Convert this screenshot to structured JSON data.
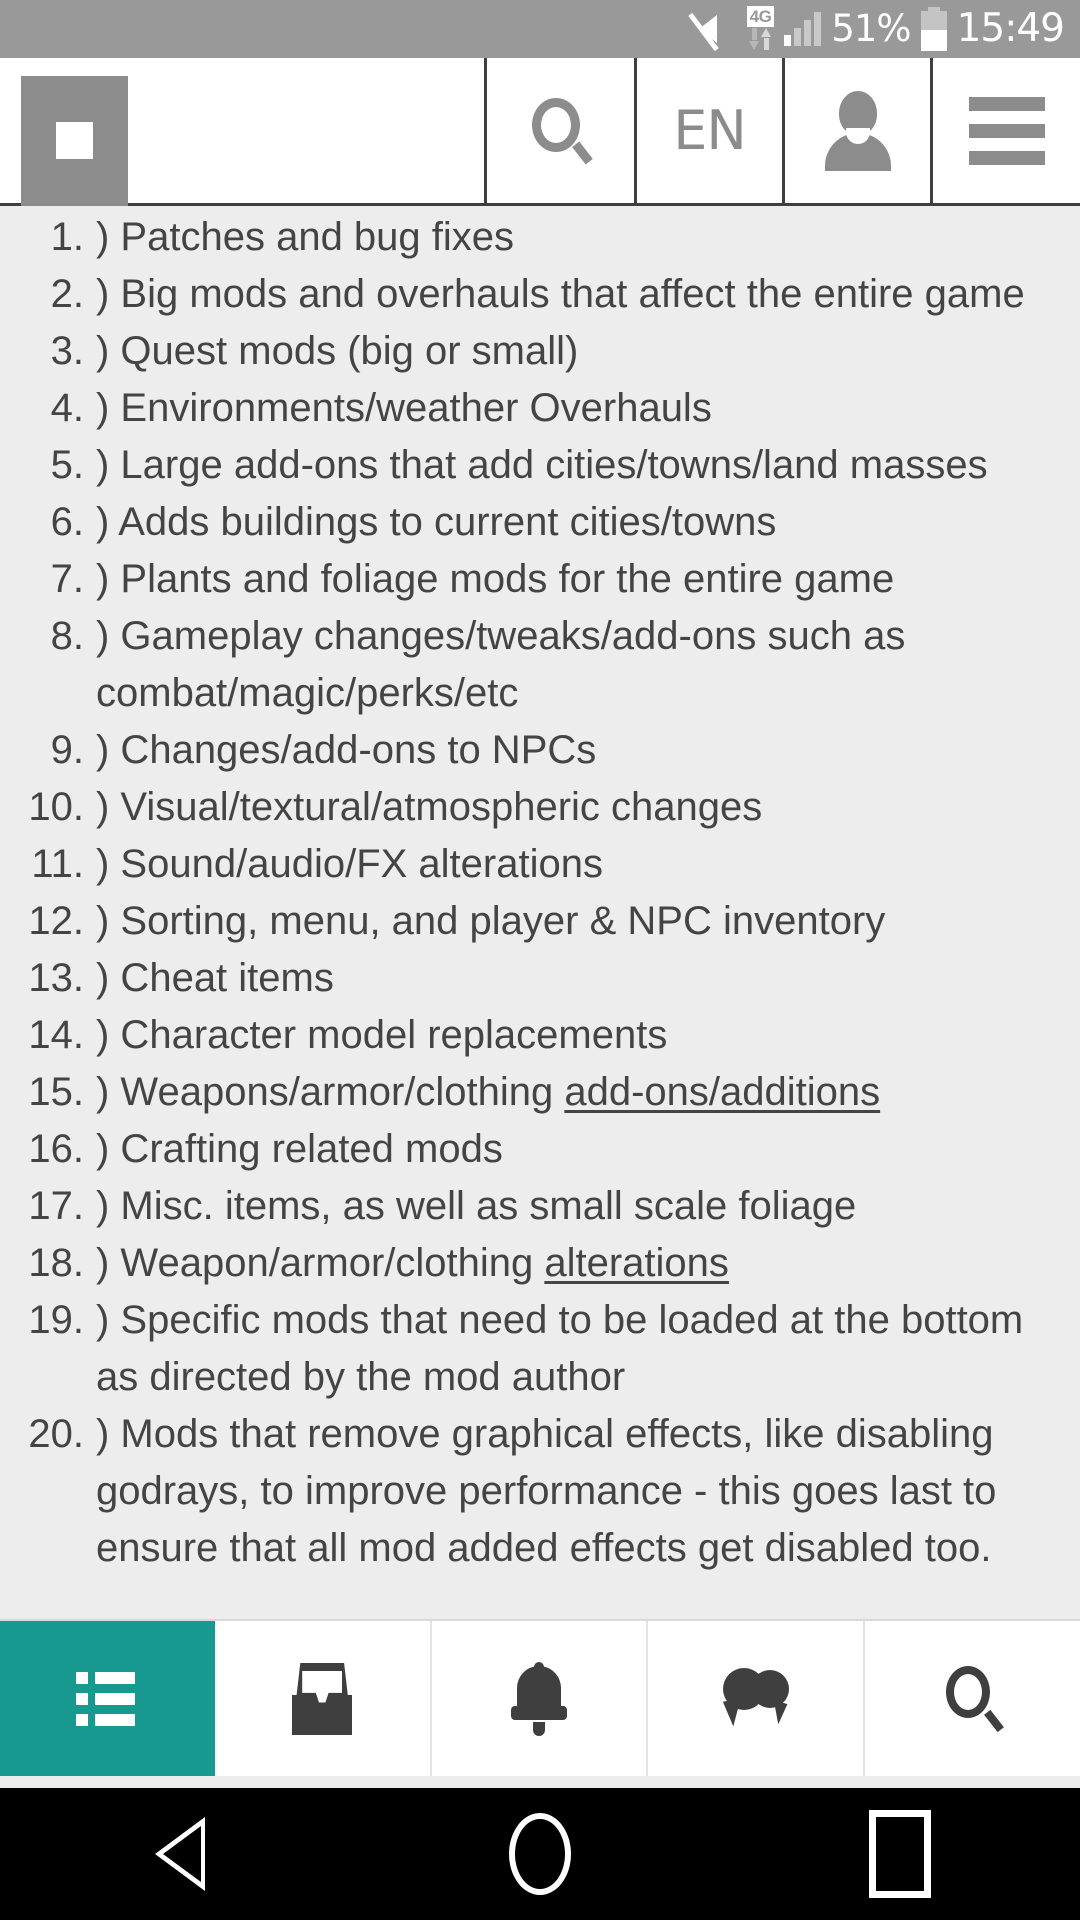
{
  "status_bar": {
    "mute_icon": "mute-icon",
    "network_label": "4G",
    "data_arrows_icon": "data-transfer-arrows-icon",
    "signal_icon": "signal-bars-icon",
    "battery_percent": "51%",
    "battery_icon": "battery-icon",
    "clock": "15:49"
  },
  "header": {
    "logo_alt": "site-logo-placeholder",
    "search_icon": "search-icon",
    "language_label": "EN",
    "account_icon": "user-account-icon",
    "menu_icon": "hamburger-menu-icon"
  },
  "content": {
    "list_type": "ordered",
    "items": [
      {
        "num": "1.",
        "prefix": ") ",
        "text": "Patches and bug fixes"
      },
      {
        "num": "2.",
        "prefix": ") ",
        "text": "Big mods and overhauls that affect the entire game"
      },
      {
        "num": "3.",
        "prefix": ") ",
        "text": "Quest mods (big or small)"
      },
      {
        "num": "4.",
        "prefix": ") ",
        "text": "Environments/weather Overhauls"
      },
      {
        "num": "5.",
        "prefix": ") ",
        "text": "Large add-ons that add cities/towns/land masses"
      },
      {
        "num": "6.",
        "prefix": ") ",
        "text": "Adds buildings to current cities/towns"
      },
      {
        "num": "7.",
        "prefix": ") ",
        "text": "Plants and foliage mods for the entire game"
      },
      {
        "num": "8.",
        "prefix": ") ",
        "text": "Gameplay changes/tweaks/add-ons such as combat/magic/perks/etc"
      },
      {
        "num": "9.",
        "prefix": ") ",
        "text": "Changes/add-ons to NPCs"
      },
      {
        "num": "10.",
        "prefix": ") ",
        "text": "Visual/textural/atmospheric changes"
      },
      {
        "num": "11.",
        "prefix": ") ",
        "text": "Sound/audio/FX alterations"
      },
      {
        "num": "12.",
        "prefix": ") ",
        "text": "Sorting, menu, and player & NPC inventory"
      },
      {
        "num": "13.",
        "prefix": ") ",
        "text": "Cheat items"
      },
      {
        "num": "14.",
        "prefix": ") ",
        "text": "Character model replacements"
      },
      {
        "num": "15.",
        "prefix": ") ",
        "text": "Weapons/armor/clothing ",
        "link_text": "add-ons/additions"
      },
      {
        "num": "16.",
        "prefix": ") ",
        "text": "Crafting related mods"
      },
      {
        "num": "17.",
        "prefix": ") ",
        "text": "Misc. items, as well as small scale foliage"
      },
      {
        "num": "18.",
        "prefix": ") ",
        "text": "Weapon/armor/clothing ",
        "link_text": "alterations"
      },
      {
        "num": "19.",
        "prefix": ") ",
        "text": "Specific mods that need to be loaded at the bottom as directed by the mod author"
      },
      {
        "num": "20.",
        "prefix": ") ",
        "text": "Mods that remove graphical effects, like disabling godrays, to improve performance - this goes last to ensure that all mod added effects get disabled too."
      }
    ]
  },
  "bottom_nav": {
    "active_index": 0,
    "active_color": "#17998f",
    "items": [
      {
        "icon": "list-icon",
        "label": "Forums"
      },
      {
        "icon": "inbox-icon",
        "label": "Inbox"
      },
      {
        "icon": "bell-icon",
        "label": "Notifications"
      },
      {
        "icon": "chat-bubbles-icon",
        "label": "Conversations"
      },
      {
        "icon": "search-icon",
        "label": "Search"
      }
    ]
  },
  "android_nav": {
    "back_icon": "back-triangle-icon",
    "home_icon": "home-circle-icon",
    "recents_icon": "recents-square-icon"
  },
  "colors": {
    "status_bar_bg": "#999999",
    "page_bg": "#ededed",
    "header_bg": "#ffffff",
    "text": "#444444",
    "icon_gray": "#8c8c8c",
    "teal_accent": "#17998f",
    "nav_bar_bg": "#000000"
  }
}
